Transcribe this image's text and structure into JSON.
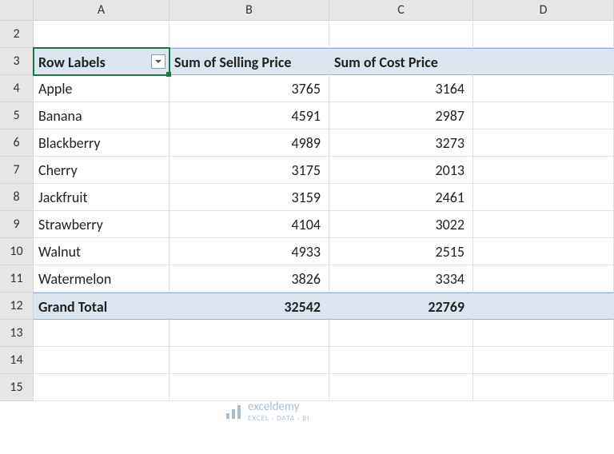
{
  "columns": [
    "A",
    "B",
    "C",
    "D"
  ],
  "rowStart": 2,
  "rowEnd": 15,
  "pivot": {
    "headerRow": 3,
    "totalRow": 12,
    "headers": {
      "rowLabel": "Row Labels",
      "col1": "Sum of Selling Price",
      "col2": "Sum of Cost Price"
    },
    "rows": [
      {
        "label": "Apple",
        "selling": "3765",
        "cost": "3164"
      },
      {
        "label": "Banana",
        "selling": "4591",
        "cost": "2987"
      },
      {
        "label": "Blackberry",
        "selling": "4989",
        "cost": "3273"
      },
      {
        "label": "Cherry",
        "selling": "3175",
        "cost": "2013"
      },
      {
        "label": "Jackfruit",
        "selling": "3159",
        "cost": "2461"
      },
      {
        "label": "Strawberry",
        "selling": "4104",
        "cost": "3022"
      },
      {
        "label": "Walnut",
        "selling": "4933",
        "cost": "2515"
      },
      {
        "label": "Watermelon",
        "selling": "3826",
        "cost": "3334"
      }
    ],
    "total": {
      "label": "Grand Total",
      "selling": "32542",
      "cost": "22769"
    }
  },
  "activeCell": "A3",
  "watermark": {
    "brand": "exceldemy",
    "tag": "EXCEL · DATA · BI"
  }
}
